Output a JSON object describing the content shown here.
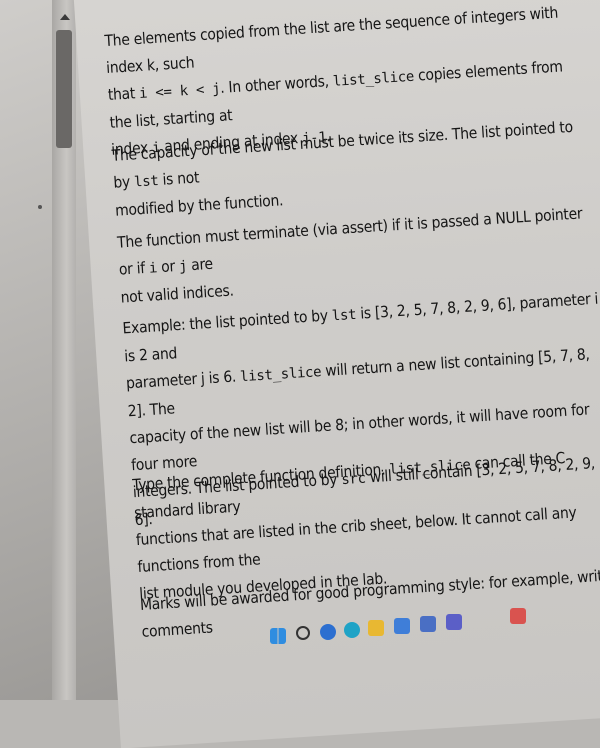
{
  "paragraphs": {
    "p1": {
      "line1": "The elements copied from the list are the sequence of integers with index k, such",
      "line2_pre": "that ",
      "line2_code1": "i <= k < j",
      "line2_mid": ". In other words, ",
      "line2_code2": "list_slice",
      "line2_post": " copies elements from the list, starting at",
      "line3_pre": "index ",
      "line3_code1": "i",
      "line3_mid": " and ending at index ",
      "line3_code2": "j-1",
      "line3_post": "."
    },
    "p2": {
      "line1_pre": "The capacity of the new list must be twice its size. The list pointed to by ",
      "line1_code": "lst",
      "line1_post": " is not",
      "line2": "modified by the function."
    },
    "p3": {
      "line1_pre": "The function must terminate (via assert) if it is passed a NULL pointer or if ",
      "line1_code1": "i",
      "line1_mid": " or ",
      "line1_code2": "j",
      "line1_post": " are",
      "line2": "not valid indices."
    },
    "p4": {
      "line1_pre": "Example: the list pointed to by ",
      "line1_code": "lst",
      "line1_post": " is [3, 2, 5, 7, 8, 2, 9, 6], parameter i is 2 and",
      "line2_pre": "parameter j is 6. ",
      "line2_code": "list_slice",
      "line2_post": " will return a new list containing [5, 7, 8, 2]. The",
      "line3": "capacity of the new list will be 8; in other words, it will have room for four more",
      "line4_pre": "integers. The list pointed to by ",
      "line4_code": "src",
      "line4_post": " will still contain [3, 2, 5, 7, 8, 2, 9, 6]."
    },
    "p5": {
      "line1_pre": "Type the complete function definition. ",
      "line1_code": "list_slice",
      "line1_post": " can call the C standard library",
      "line2": "functions that are listed in the crib sheet, below. It cannot call any functions from the",
      "line3": "list module you developed in the lab."
    },
    "p6": {
      "line1": "Marks will be awarded for good programming style: for example, writing comments"
    }
  },
  "colors": {
    "text": "#151515",
    "page": "#d2d0cd",
    "bezel": "#a9a7a4"
  },
  "taskbar_icons": [
    "windows-icon",
    "search-icon",
    "task-view-icon",
    "edge-icon",
    "file-explorer-icon",
    "store-icon",
    "mail-icon",
    "teams-icon",
    "app-icon"
  ]
}
